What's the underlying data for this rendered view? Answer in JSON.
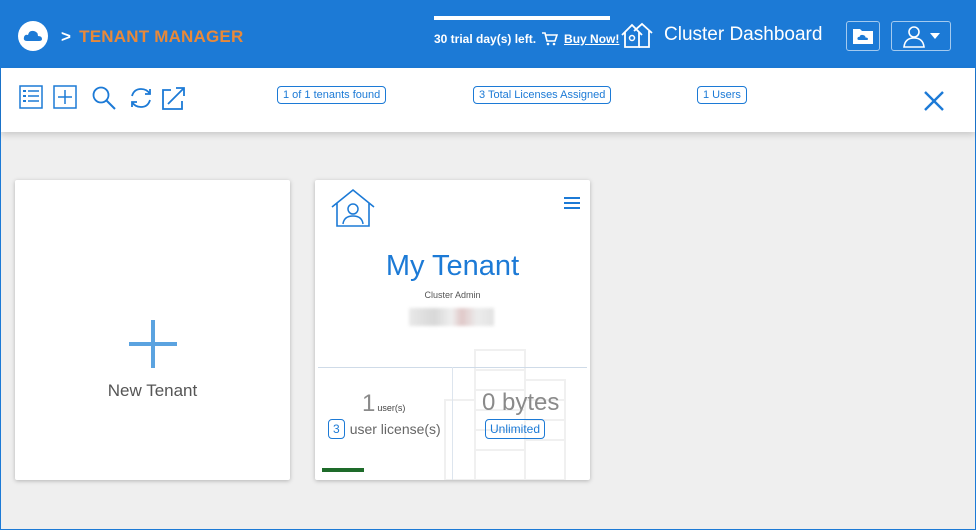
{
  "header": {
    "breadcrumb_sep": ">",
    "breadcrumb": "TENANT MANAGER",
    "trial_text": "30 trial day(s) left.",
    "buy_now": "Buy Now!",
    "cluster_dashboard": "Cluster Dashboard",
    "accent": "#1c7ad6",
    "crumb_color": "#e8893a"
  },
  "toolbar": {
    "icons": [
      "list-view-icon",
      "add-icon",
      "search-icon",
      "sync-icon",
      "export-icon"
    ],
    "tenants_found": "1 of 1 tenants found",
    "licenses_assigned": "3 Total Licenses Assigned",
    "users": "1 Users"
  },
  "new_tenant": {
    "label": "New Tenant"
  },
  "tenant": {
    "name": "My Tenant",
    "role": "Cluster Admin",
    "user_count": "1",
    "user_unit": "user(s)",
    "license_count": "3",
    "license_label": "user license(s)",
    "storage": "0 bytes",
    "quota": "Unlimited"
  }
}
